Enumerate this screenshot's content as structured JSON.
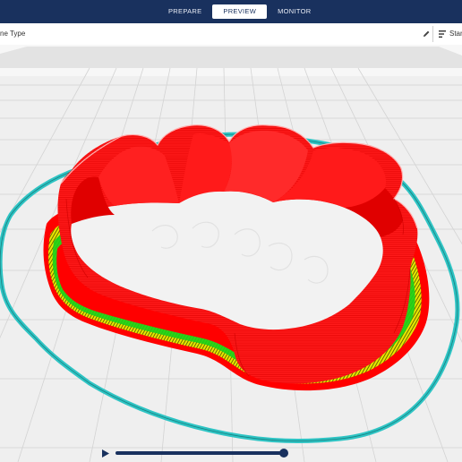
{
  "header": {
    "tabs": [
      {
        "label": "PREPARE",
        "active": false
      },
      {
        "label": "PREVIEW",
        "active": true
      },
      {
        "label": "MONITOR",
        "active": false
      }
    ]
  },
  "view_panel": {
    "label": "ne Type",
    "edit_icon": "pencil-icon"
  },
  "print_settings": {
    "label": "Stan",
    "icon": "sliders-icon"
  },
  "colors": {
    "header_bg": "#19315e",
    "wall": "#ff0000",
    "infill": "#e8e800",
    "skirt": "#2ec4c4",
    "build_plate": "#ececec",
    "accent": "#19315e"
  },
  "layer_scrubber": {
    "play_icon": "play-icon",
    "progress": 0.98
  }
}
